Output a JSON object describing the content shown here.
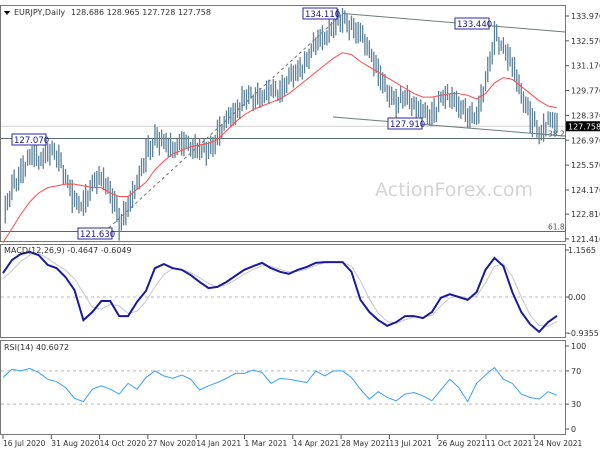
{
  "header": {
    "symbol": "EURJPY,Daily",
    "ohlc": "128.686 128.965 127.728 127.758"
  },
  "watermark": "ActionForex.com",
  "colors": {
    "bars": "#5b8099",
    "ma": "#ff4a4a",
    "macd": "#1a1a9a",
    "signal": "#c8c8c8",
    "rsi": "#3aa0ff",
    "label": "#2a2aa0"
  },
  "chart_data": [
    {
      "type": "bar",
      "title": "EURJPY,Daily",
      "y_ticks": [
        "133.970",
        "132.570",
        "131.170",
        "129.770",
        "128.370",
        "126.970",
        "125.570",
        "124.170",
        "122.810",
        "121.410"
      ],
      "ylim": [
        121.2,
        134.3
      ],
      "current_price": "127.758",
      "x_ticks": [
        "16 Jul 2020",
        "31 Aug 2020",
        "14 Oct 2020",
        "27 Nov 2020",
        "14 Jan 2021",
        "1 Mar 2021",
        "14 Apr 2021",
        "28 May 2021",
        "13 Jul 2021",
        "26 Aug 2021",
        "11 Oct 2021",
        "24 Nov 2021"
      ],
      "close": [
        122.8,
        124.3,
        125.3,
        126.0,
        126.0,
        126.4,
        126.1,
        124.9,
        123.2,
        123.5,
        124.5,
        124.9,
        124.1,
        122.1,
        123.6,
        124.5,
        126.3,
        127.1,
        126.7,
        126.6,
        126.8,
        126.7,
        126.4,
        126.3,
        127.4,
        128.0,
        128.7,
        129.4,
        129.4,
        129.6,
        129.7,
        129.8,
        130.4,
        130.9,
        131.6,
        132.5,
        133.0,
        133.3,
        133.9,
        133.2,
        132.8,
        132.0,
        130.5,
        129.8,
        129.0,
        129.5,
        128.9,
        128.3,
        128.5,
        129.3,
        129.5,
        129.0,
        128.2,
        128.6,
        130.3,
        133.0,
        132.0,
        131.0,
        129.6,
        128.1,
        127.4,
        128.1,
        127.758
      ],
      "moving_average": [
        121.2,
        122.0,
        122.8,
        123.5,
        124.0,
        124.3,
        124.4,
        124.5,
        124.5,
        124.4,
        124.3,
        124.3,
        124.0,
        123.8,
        123.8,
        124.2,
        124.6,
        125.3,
        125.8,
        126.2,
        126.4,
        126.6,
        126.7,
        126.8,
        127.0,
        127.5,
        128.0,
        128.4,
        128.7,
        128.9,
        129.1,
        129.3,
        129.6,
        130.0,
        130.4,
        130.8,
        131.2,
        131.6,
        131.9,
        131.8,
        131.4,
        131.1,
        130.8,
        130.5,
        130.2,
        129.9,
        129.6,
        129.4,
        129.4,
        129.5,
        129.6,
        129.6,
        129.5,
        129.3,
        129.6,
        130.2,
        130.5,
        130.4,
        130.0,
        129.6,
        129.2,
        128.9,
        128.8
      ],
      "annotations": [
        {
          "text": "134.110",
          "price": 134.11
        },
        {
          "text": "133.440",
          "price": 133.44
        },
        {
          "text": "127.910",
          "price": 127.91
        },
        {
          "text": "127.070",
          "price": 127.07
        },
        {
          "text": "121.630",
          "price": 121.63
        }
      ],
      "horizontal_levels": [
        {
          "price": 127.07,
          "label": "38.2"
        },
        {
          "price": 121.83,
          "label": "61.8"
        }
      ]
    },
    {
      "type": "line",
      "title": "MACD(12,26,9) -0.4647 -0.6049",
      "y_ticks": [
        "1.1565",
        "0.00",
        "-0.9355"
      ],
      "ylim": [
        -0.9355,
        1.1565
      ],
      "series": [
        {
          "values": [
            0.59,
            0.91,
            1.06,
            1.11,
            1.03,
            0.79,
            0.71,
            0.49,
            0.17,
            -0.57,
            -0.37,
            -0.1,
            -0.1,
            -0.47,
            -0.47,
            -0.12,
            0.15,
            0.71,
            0.81,
            0.71,
            0.67,
            0.54,
            0.37,
            0.22,
            0.25,
            0.37,
            0.52,
            0.67,
            0.76,
            0.84,
            0.71,
            0.62,
            0.57,
            0.67,
            0.74,
            0.84,
            0.86,
            0.86,
            0.86,
            0.62,
            -0.07,
            -0.37,
            -0.57,
            -0.71,
            -0.62,
            -0.47,
            -0.47,
            -0.52,
            -0.37,
            -0.02,
            0.07,
            0.0,
            -0.07,
            0.12,
            0.67,
            0.96,
            0.76,
            0.12,
            -0.37,
            -0.67,
            -0.86,
            -0.62,
            -0.4647
          ]
        },
        {
          "values": [
            0.45,
            0.65,
            0.88,
            1.03,
            1.07,
            0.95,
            0.8,
            0.66,
            0.45,
            0.1,
            -0.25,
            -0.3,
            -0.18,
            -0.22,
            -0.4,
            -0.35,
            -0.1,
            0.25,
            0.55,
            0.7,
            0.68,
            0.6,
            0.48,
            0.33,
            0.25,
            0.3,
            0.42,
            0.56,
            0.68,
            0.77,
            0.76,
            0.68,
            0.62,
            0.63,
            0.69,
            0.78,
            0.84,
            0.86,
            0.86,
            0.76,
            0.4,
            -0.05,
            -0.4,
            -0.6,
            -0.65,
            -0.56,
            -0.5,
            -0.5,
            -0.45,
            -0.22,
            -0.02,
            0.02,
            -0.03,
            0.02,
            0.35,
            0.75,
            0.82,
            0.5,
            0.0,
            -0.45,
            -0.7,
            -0.72,
            -0.6049
          ]
        }
      ]
    },
    {
      "type": "line",
      "title": "RSI(14) 40.6072",
      "y_ticks": [
        "100",
        "70",
        "30",
        "0"
      ],
      "ylim": [
        0,
        100
      ],
      "levels": [
        70,
        30
      ],
      "values": [
        62,
        72,
        70,
        73,
        68,
        60,
        57,
        50,
        37,
        33,
        48,
        52,
        48,
        42,
        55,
        48,
        62,
        70,
        64,
        61,
        65,
        60,
        47,
        52,
        56,
        61,
        67,
        67,
        71,
        68,
        55,
        61,
        60,
        58,
        56,
        70,
        64,
        70,
        70,
        62,
        48,
        36,
        45,
        38,
        34,
        42,
        44,
        40,
        34,
        47,
        60,
        50,
        33,
        55,
        65,
        74,
        60,
        55,
        42,
        38,
        36,
        45,
        40.6072
      ]
    }
  ]
}
